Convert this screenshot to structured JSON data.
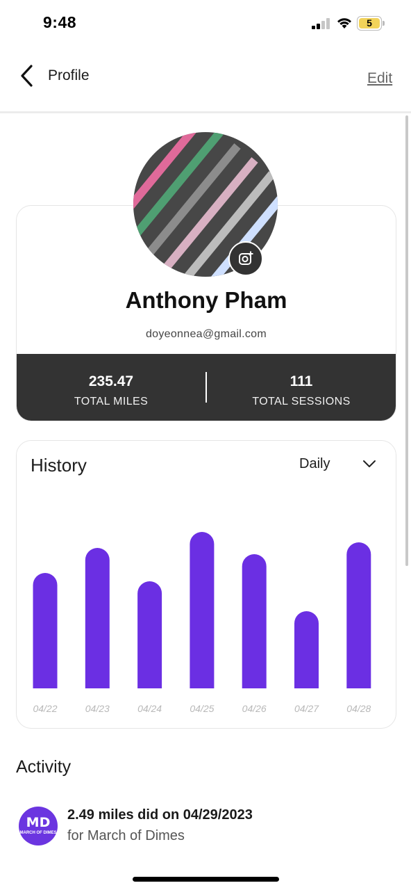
{
  "status_bar": {
    "time": "9:48",
    "battery": "5"
  },
  "nav": {
    "back_icon": "chevron-left-icon",
    "title": "Profile",
    "edit_label": "Edit"
  },
  "profile": {
    "name": "Anthony Pham",
    "email": "doyeonnea@gmail.com",
    "camera_icon": "add-photo-icon",
    "stats": [
      {
        "value": "235.47",
        "label": "TOTAL MILES"
      },
      {
        "value": "111",
        "label": "TOTAL SESSIONS"
      }
    ]
  },
  "history": {
    "title": "History",
    "range": "Daily",
    "range_icon": "chevron-down-icon"
  },
  "chart_data": {
    "type": "bar",
    "categories": [
      "04/22",
      "04/23",
      "04/24",
      "04/25",
      "04/26",
      "04/27",
      "04/28"
    ],
    "values": [
      166,
      202,
      154,
      225,
      193,
      111,
      210
    ],
    "color": "#6b2fe3"
  },
  "activity": {
    "title": "Activity",
    "items": [
      {
        "logo_text": "MD",
        "logo_caption": "MARCH OF DIMES",
        "headline": "2.49 miles did on 04/29/2023",
        "subtitle": "for March of Dimes"
      }
    ]
  },
  "colors": {
    "accent": "#6b2fe3",
    "stats_bg": "#333333",
    "logo": "#6b35e0"
  }
}
